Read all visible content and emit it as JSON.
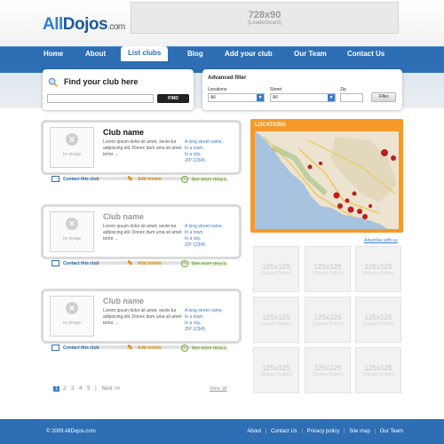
{
  "header": {
    "logo_prefix": "All",
    "logo_main": "Dojos",
    "logo_tld": ".com",
    "ad_size": "728x90",
    "ad_label": "(Leaderboard)"
  },
  "nav": {
    "items": [
      {
        "label": "Home"
      },
      {
        "label": "About"
      },
      {
        "label": "List clubs"
      },
      {
        "label": "Blog"
      },
      {
        "label": "Add your club"
      },
      {
        "label": "Our Team"
      },
      {
        "label": "Contact Us"
      }
    ],
    "active_index": 2
  },
  "search": {
    "title": "Find your club here",
    "input_value": "",
    "button_label": "FIND"
  },
  "filter": {
    "title": "Advanced filter",
    "locations_label": "Locations",
    "locations_value": "All",
    "street_label": "Street",
    "street_value": "All",
    "zip_label": "Zip",
    "zip_value": "",
    "button_label": "Filter"
  },
  "clubs": [
    {
      "name": "Club name",
      "image_placeholder": "no image",
      "description": "Lorem ipsum dolor sit amet, secte-tur adipiscing elit. Donec dum uma sit amet tortor ...",
      "address_lines": [
        "A long street name,",
        "In a town,",
        "In a city,",
        "ZIP 12345"
      ],
      "contact_label": "Contact this club",
      "review_label": "Add review",
      "more_label": "See more details"
    },
    {
      "name": "Club name",
      "image_placeholder": "no image",
      "description": "Lorem ipsum dolor sit amet, secte-tur adipiscing elit. Donec dum uma sit amet tortor ...",
      "address_lines": [
        "A long street name,",
        "In a town,",
        "In a city,",
        "ZIP 12345"
      ],
      "contact_label": "Contact this club",
      "review_label": "Add review",
      "more_label": "See more details"
    },
    {
      "name": "Club name",
      "image_placeholder": "no image",
      "description": "Lorem ipsum dolor sit amet, secte-tur adipiscing elit. Donec dum uma sit amet tortor ...",
      "address_lines": [
        "A long street name,",
        "In a town,",
        "In a city,",
        "ZIP 12345"
      ],
      "contact_label": "Contact this club",
      "review_label": "Add review",
      "more_label": "See more details"
    }
  ],
  "pagination": {
    "pages": [
      "1",
      "2",
      "3",
      "4",
      "5"
    ],
    "current": "1",
    "next_label": "Next >>",
    "view_all_label": "view all"
  },
  "sidebar": {
    "map_title": "LOCATIONS",
    "advertise_label": "Advertise with us",
    "ad_tile_size": "125x125",
    "ad_tile_label": "(Square Button)",
    "ad_tile_count": 9
  },
  "footer": {
    "copyright": "© 2009 AllDojos.com",
    "links": [
      "About",
      "Contact Us",
      "Privacy policy",
      "Site map",
      "Our Team"
    ]
  },
  "colors": {
    "brand_blue": "#2d6eb4",
    "link_blue": "#3a7bc8",
    "map_orange": "#f59a2a",
    "review_orange": "#e38a12",
    "more_green": "#6aa82a"
  }
}
